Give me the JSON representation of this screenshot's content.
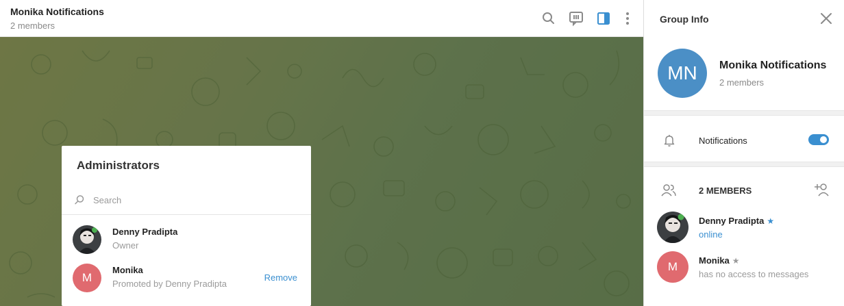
{
  "chat": {
    "title": "Monika Notifications",
    "subtitle": "2 members"
  },
  "header_icons": [
    "search-icon",
    "chat-bubble-icon",
    "sidebar-toggle-icon",
    "more-vertical-icon"
  ],
  "dialog": {
    "title": "Administrators",
    "search_placeholder": "Search",
    "admins": [
      {
        "name": "Denny Pradipta",
        "subtitle": "Owner",
        "avatar": "photo",
        "action": ""
      },
      {
        "name": "Monika",
        "subtitle": "Promoted by Denny Pradipta",
        "avatar": "M",
        "action": "Remove"
      }
    ]
  },
  "panel": {
    "title": "Group Info",
    "group_initials": "MN",
    "group_name": "Monika Notifications",
    "group_subtitle": "2 members",
    "notifications_label": "Notifications",
    "notifications_enabled": true,
    "members_heading": "2 MEMBERS",
    "members": [
      {
        "name": "Denny Pradipta",
        "star": "★",
        "star_color": "#3a8fd0",
        "status": "online",
        "status_color": "#3a8fd0",
        "avatar": "photo"
      },
      {
        "name": "Monika",
        "star": "★",
        "star_color": "#9a9a9a",
        "status": "has no access to messages",
        "status_color": "#9a9a9a",
        "avatar": "M"
      }
    ]
  },
  "colors": {
    "accent": "#3a8fd0",
    "group_avatar": "#4b8fc6",
    "letter_avatar": "#e06a6f"
  }
}
